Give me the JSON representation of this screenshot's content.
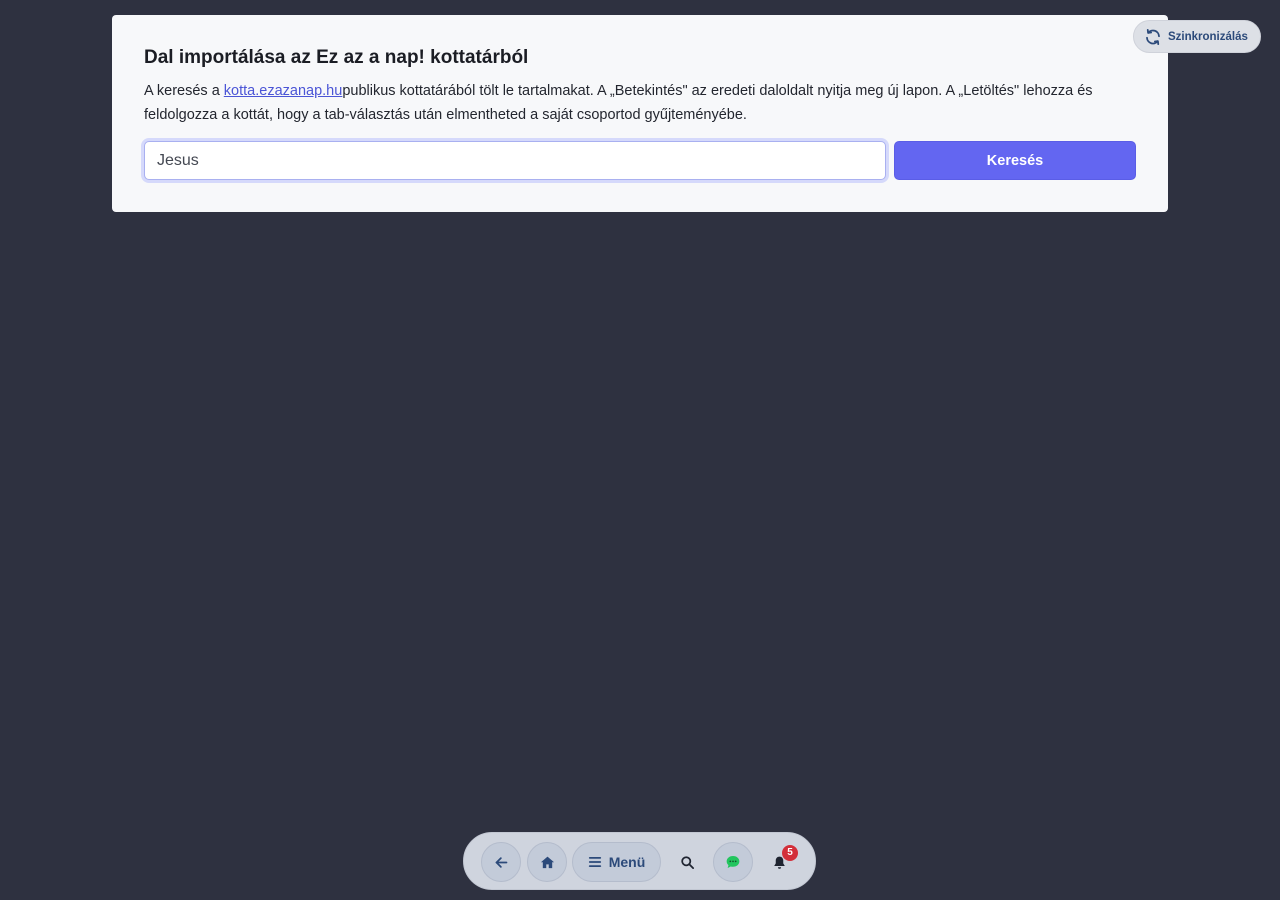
{
  "import_card": {
    "title": "Dal importálása az Ez az a nap! kottatárból",
    "desc_prefix": "A keresés a ",
    "link_text": "kotta.ezazanap.hu",
    "desc_suffix": "publikus kottatárából tölt le tartalmakat. A „Betekintés\" az eredeti daloldalt nyitja meg új lapon. A „Letöltés\" lehozza és feldolgozza a kottát, hogy a tab-választás után elmentheted a saját csoportod gyűjteményébe.",
    "search_value": "Jesus",
    "search_button": "Keresés"
  },
  "sync": {
    "label": "Szinkronizálás",
    "icon": "sync-icon"
  },
  "bottom_nav": {
    "back_icon": "arrow-left-icon",
    "home_icon": "home-icon",
    "menu_label": "Menü",
    "menu_icon": "hamburger-icon",
    "search_icon": "search-icon",
    "chat_icon": "chat-icon",
    "bell_icon": "bell-icon",
    "notification_count": "5"
  },
  "colors": {
    "background": "#2e3140",
    "primary": "#6366f1",
    "link": "#4b55d6",
    "nav_text": "#2c4a7a",
    "chat_green": "#22c55e",
    "badge_red": "#d32f3a"
  }
}
